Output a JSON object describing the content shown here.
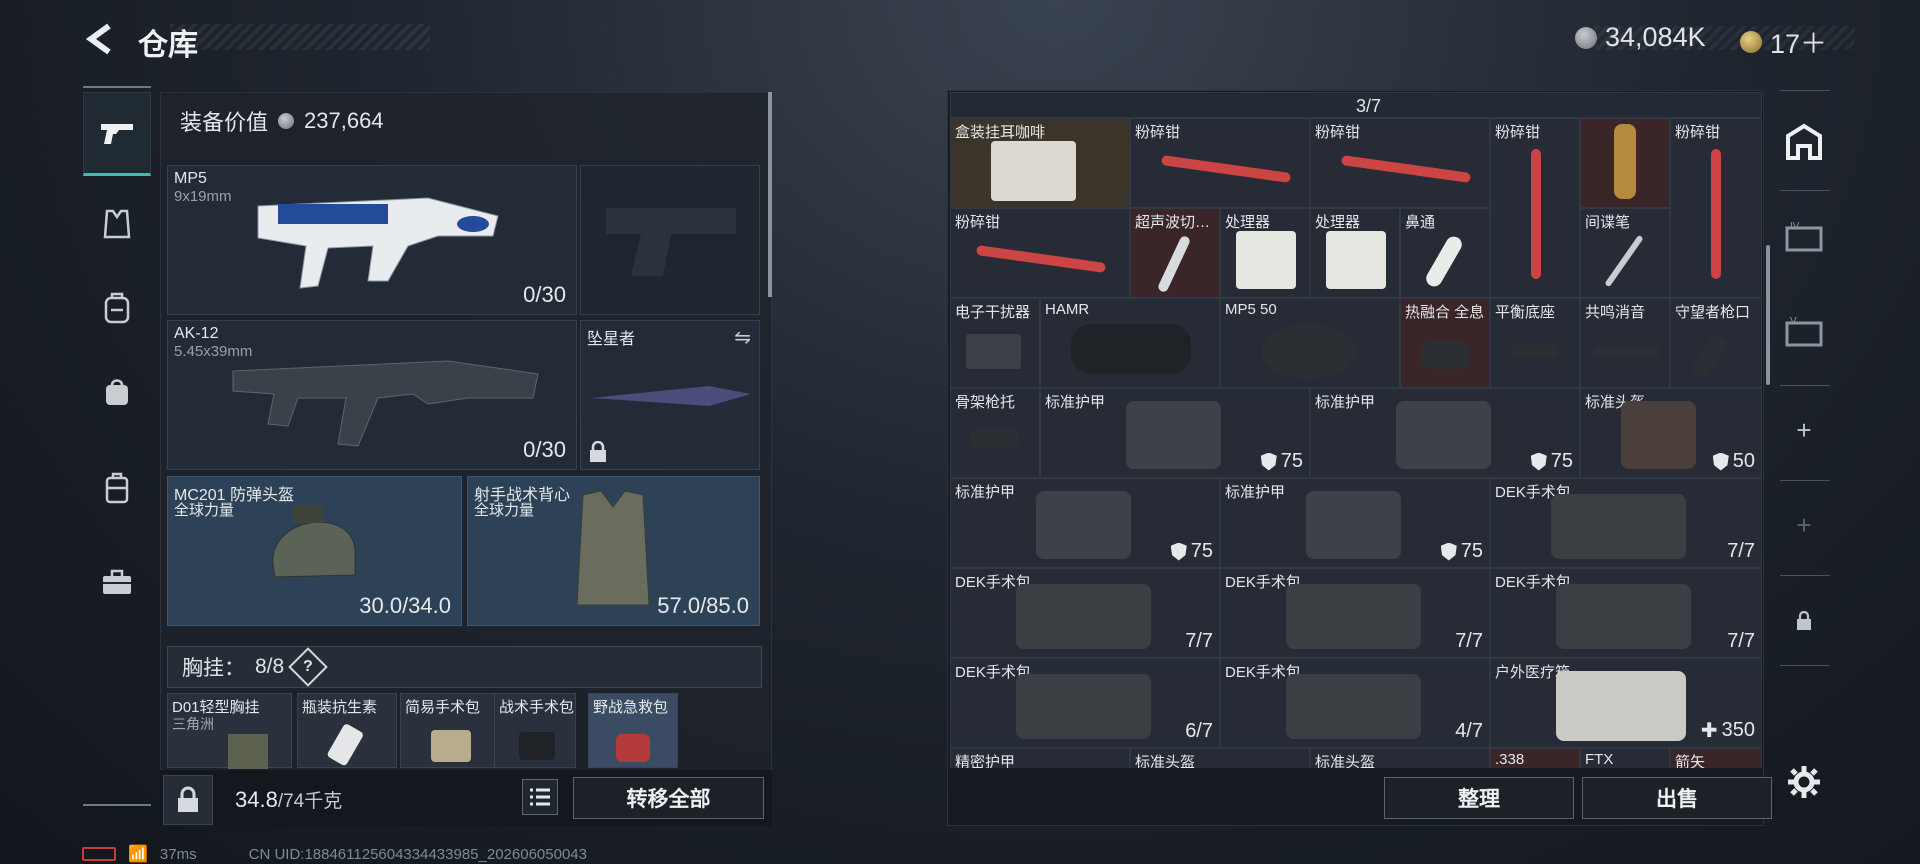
{
  "header": {
    "title": "仓库",
    "currency_silver": "34,084K",
    "currency_gold": "17＋"
  },
  "left": {
    "equip_value_label": "装备价值",
    "equip_value": "237,664",
    "primary": {
      "name": "MP5",
      "caliber": "9x19mm",
      "ammo": "0/30"
    },
    "secondary": {
      "name": "AK-12",
      "caliber": "5.45x39mm",
      "ammo": "0/30"
    },
    "melee": {
      "name": "坠星者"
    },
    "helmet": {
      "name": "MC201 防弹头盔",
      "faction": "全球力量",
      "durability": "30.0/34.0"
    },
    "vest": {
      "name": "射手战术背心",
      "faction": "全球力量",
      "durability": "57.0/85.0"
    },
    "rig": {
      "label": "胸挂：",
      "count": "8/8",
      "help": "?"
    },
    "rig_items": [
      {
        "name": "D01轻型胸挂",
        "sub": "三角洲"
      },
      {
        "name": "瓶装抗生素",
        "sub": ""
      },
      {
        "name": "简易手术包",
        "sub": ""
      },
      {
        "name": "战术手术包",
        "sub": ""
      },
      {
        "name": "野战急救包",
        "sub": ""
      }
    ],
    "weight": "34.8",
    "weight_max": "/74千克",
    "transfer_all": "转移全部"
  },
  "grid": {
    "row0": {
      "count": "3/7"
    },
    "cells": [
      {
        "name": "盒装挂耳咖啡",
        "count": ""
      },
      {
        "name": "粉碎钳"
      },
      {
        "name": "粉碎钳"
      },
      {
        "name": "粉碎钳"
      },
      {
        "name": ""
      },
      {
        "name": "粉碎钳"
      },
      {
        "name": "粉碎钳"
      },
      {
        "name": "超声波切…"
      },
      {
        "name": "处理器"
      },
      {
        "name": "处理器"
      },
      {
        "name": "鼻通"
      },
      {
        "name": "间谍笔"
      },
      {
        "name": "电子干扰器"
      },
      {
        "name": "HAMR"
      },
      {
        "name": "MP5 50"
      },
      {
        "name": "热融合 全息"
      },
      {
        "name": "平衡底座"
      },
      {
        "name": "共鸣消音"
      },
      {
        "name": "守望者枪口"
      },
      {
        "name": "骨架枪托"
      },
      {
        "name": "标准护甲",
        "value": "75"
      },
      {
        "name": "标准护甲",
        "value": "75"
      },
      {
        "name": "标准头盔",
        "value": "50"
      },
      {
        "name": "标准护甲",
        "value": "75"
      },
      {
        "name": "标准护甲",
        "value": "75"
      },
      {
        "name": "DEK手术包",
        "value": "7/7"
      },
      {
        "name": "DEK手术包",
        "value": "7/7"
      },
      {
        "name": "DEK手术包",
        "value": "7/7"
      },
      {
        "name": "DEK手术包",
        "value": "7/7"
      },
      {
        "name": "DEK手术包",
        "value": "6/7"
      },
      {
        "name": "DEK手术包",
        "value": "4/7"
      },
      {
        "name": "户外医疗箱",
        "value": "350"
      },
      {
        "name": "精密护甲"
      },
      {
        "name": "标准头盔"
      },
      {
        "name": "标准头盔"
      },
      {
        "name": ".338"
      },
      {
        "name": "FTX"
      },
      {
        "name": "箭矢"
      }
    ],
    "sort": "整理",
    "sell": "出售"
  },
  "status": {
    "ping": "37ms",
    "uid": "CN UID:18846112560433443398​5_202606050043"
  }
}
